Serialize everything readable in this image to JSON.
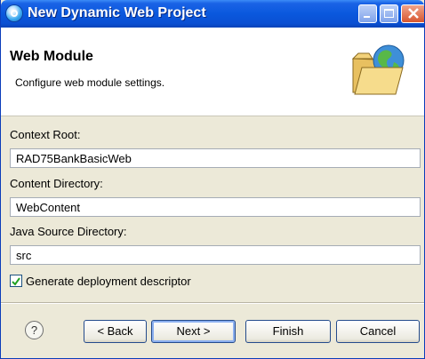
{
  "window": {
    "title": "New Dynamic Web Project",
    "title_icon": "eclipse-icon"
  },
  "header": {
    "title": "Web Module",
    "description": "Configure web module settings.",
    "icon": "web-module-folder-globe-icon"
  },
  "form": {
    "context_root": {
      "label": "Context Root:",
      "value": "RAD75BankBasicWeb"
    },
    "content_directory": {
      "label": "Content Directory:",
      "value": "WebContent"
    },
    "java_source_directory": {
      "label": "Java Source Directory:",
      "value": "src"
    },
    "generate_descriptor": {
      "label": "Generate deployment descriptor",
      "checked": true
    }
  },
  "buttons": {
    "help": "?",
    "back": "< Back",
    "next": "Next >",
    "finish": "Finish",
    "cancel": "Cancel"
  },
  "colors": {
    "title_bar": "#0a58dd",
    "dialog_bg": "#ece9d8",
    "header_bg": "#ffffff",
    "close_button": "#d8562f"
  }
}
